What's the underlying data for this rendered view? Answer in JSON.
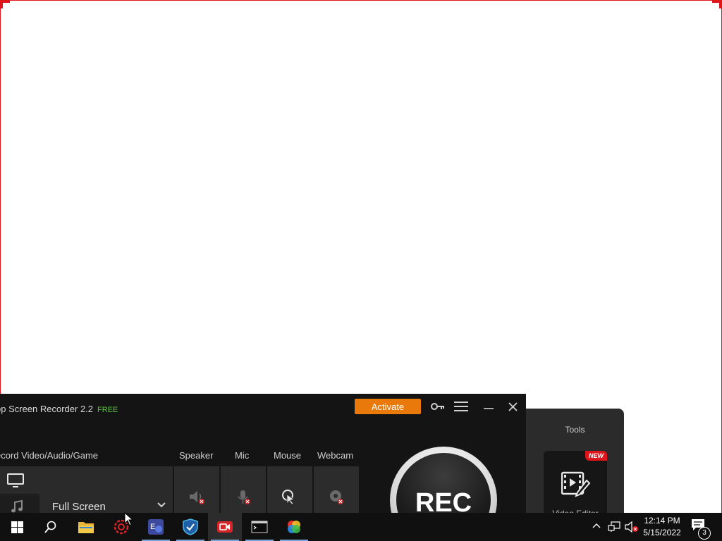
{
  "recorder": {
    "app_title": "pp Screen Recorder 2.2",
    "free_tag": "FREE",
    "activate_label": "Activate",
    "record_section_label": "ecord Video/Audio/Game",
    "mode_selected": "Full Screen",
    "toggles": {
      "speaker_label": "Speaker",
      "mic_label": "Mic",
      "mouse_label": "Mouse",
      "webcam_label": "Webcam"
    },
    "rec_label": "REC"
  },
  "tools": {
    "title": "Tools",
    "video_editor_label": "Video Editor",
    "new_badge": "NEW"
  },
  "taskbar": {
    "clock_time": "12:14 PM",
    "clock_date": "5/15/2022",
    "notification_count": "3",
    "icons": [
      "windows-start-icon",
      "search-icon",
      "file-explorer-icon",
      "red-gear-app-icon",
      "translator-app-icon",
      "shield-app-icon",
      "screen-recorder-app-icon",
      "terminal-icon",
      "color-wheel-app-icon"
    ]
  },
  "colors": {
    "frame_red": "#e0151b",
    "activate_orange": "#e9790b",
    "free_green": "#5cc540",
    "panel_bg": "#141414"
  }
}
